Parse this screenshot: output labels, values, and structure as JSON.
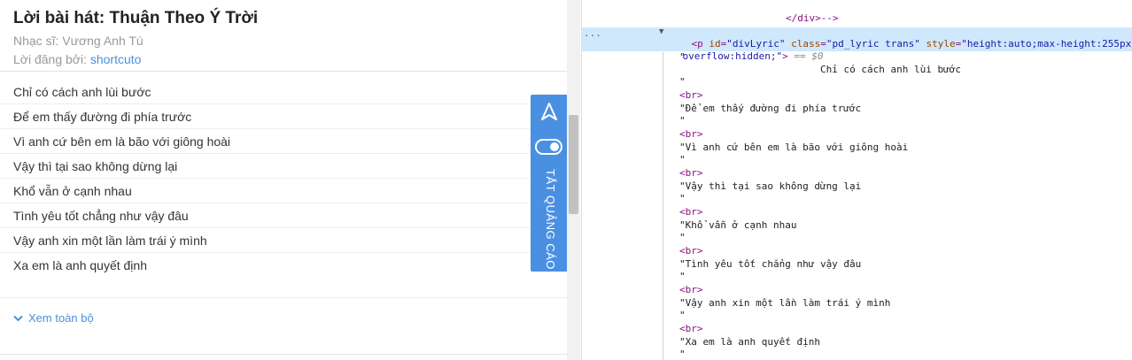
{
  "song": {
    "title": "Lời bài hát: Thuận Theo Ý Trời",
    "composer": "Nhạc sĩ: Vương Anh Tú",
    "posted_by_prefix": "Lời đăng bởi: ",
    "posted_by_user": "shortcuto"
  },
  "lyrics": [
    "Chỉ có cách anh lùi bước",
    "Để em thấy đường đi phía trước",
    "Vì anh cứ bên em là bão với giông hoài",
    "Vậy thì tại sao không dừng lại",
    "Khổ vẫn ở cạnh nhau",
    "Tình yêu tốt chẳng như vậy đâu",
    "Vậy anh xin một lần làm trái ý mình",
    "Xa em là anh quyết định"
  ],
  "see_all": "Xem toàn bộ",
  "ad_panel": {
    "label": "TẮT QUẢNG CÁO"
  },
  "devtools": {
    "closing_div": "</div>-->",
    "p_open_tag": "<p",
    "p_id_attr": "id",
    "p_id_val": "\"divLyric\"",
    "p_class_attr": "class",
    "p_class_val": "\"pd_lyric trans\"",
    "p_style_attr": "style",
    "p_style_val": "\"height:auto;max-height:255px;",
    "p_style_val2": "overflow:hidden;\"",
    "p_close": ">",
    "p_marker": "== $0",
    "dots": "...",
    "br": "<br>",
    "quote": "\"",
    "text_nodes": [
      "Chỉ có cách anh lùi bước",
      "\"Để em thấy đường đi phía trước",
      "\"Vì anh cứ bên em là bão với giông hoài",
      "\"Vậy thì tại sao không dừng lại",
      "\"Khổ vẫn ở cạnh nhau",
      "\"Tình yêu tốt chẳng như vậy đâu",
      "\"Vậy anh xin một lần làm trái ý mình",
      "\"Xa em là anh quyết định"
    ]
  }
}
